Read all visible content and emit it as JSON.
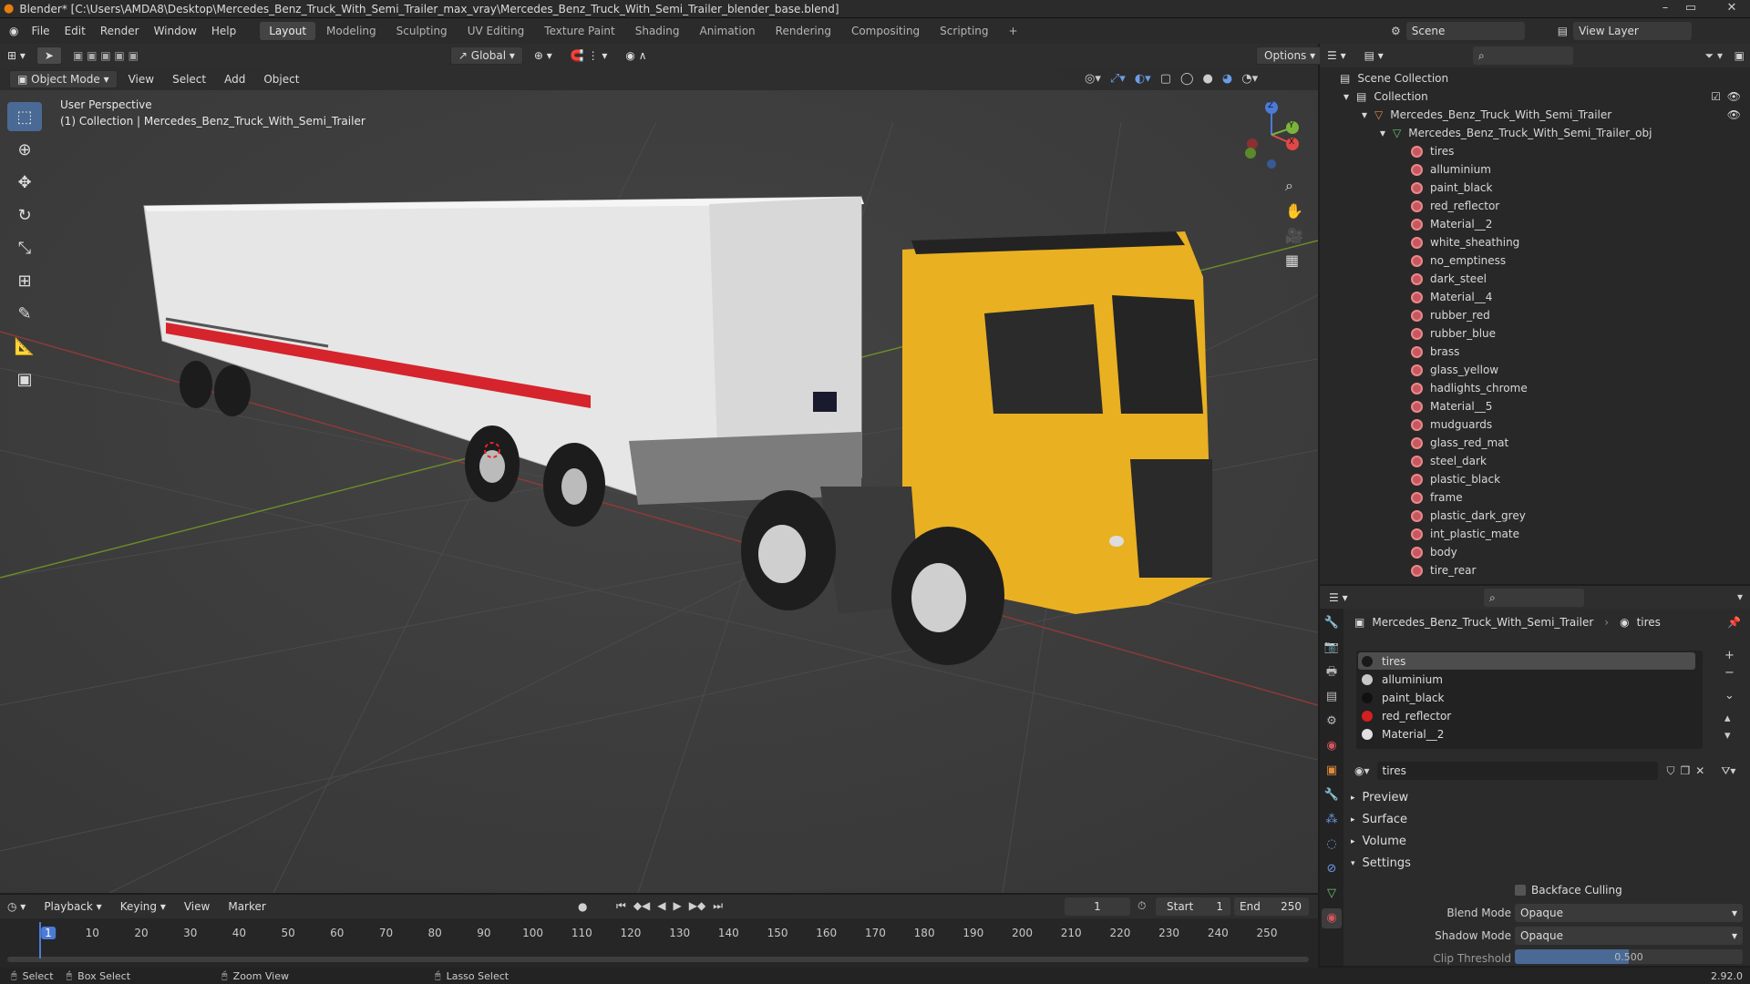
{
  "window": {
    "title": "Blender* [C:\\Users\\AMDA8\\Desktop\\Mercedes_Benz_Truck_With_Semi_Trailer_max_vray\\Mercedes_Benz_Truck_With_Semi_Trailer_blender_base.blend]"
  },
  "menu": [
    "File",
    "Edit",
    "Render",
    "Window",
    "Help"
  ],
  "workspaces": [
    "Layout",
    "Modeling",
    "Sculpting",
    "UV Editing",
    "Texture Paint",
    "Shading",
    "Animation",
    "Rendering",
    "Compositing",
    "Scripting"
  ],
  "active_workspace": "Layout",
  "topbar_right": {
    "scene_label": "Scene",
    "viewlayer_label": "View Layer"
  },
  "viewport": {
    "orientation": "Global",
    "options_label": "Options",
    "mode": "Object Mode",
    "menus": [
      "View",
      "Select",
      "Add",
      "Object"
    ],
    "overlay_line1": "User Perspective",
    "overlay_line2": "(1) Collection | Mercedes_Benz_Truck_With_Semi_Trailer",
    "gizmo": {
      "x": "X",
      "y": "Y",
      "z": "Z"
    }
  },
  "outliner": {
    "scene_collection": "Scene Collection",
    "collection": "Collection",
    "object": "Mercedes_Benz_Truck_With_Semi_Trailer",
    "mesh": "Mercedes_Benz_Truck_With_Semi_Trailer_obj",
    "materials": [
      "tires",
      "alluminium",
      "paint_black",
      "red_reflector",
      "Material__2",
      "white_sheathing",
      "no_emptiness",
      "dark_steel",
      "Material__4",
      "rubber_red",
      "rubber_blue",
      "brass",
      "glass_yellow",
      "hadlights_chrome",
      "Material__5",
      "mudguards",
      "glass_red_mat",
      "steel_dark",
      "plastic_black",
      "frame",
      "plastic_dark_grey",
      "int_plastic_mate",
      "body",
      "tire_rear"
    ]
  },
  "properties": {
    "breadcrumb_object": "Mercedes_Benz_Truck_With_Semi_Trailer",
    "breadcrumb_material": "tires",
    "slots": [
      {
        "name": "tires",
        "color": "#1a1a1a"
      },
      {
        "name": "alluminium",
        "color": "#c8c8c8"
      },
      {
        "name": "paint_black",
        "color": "#111111"
      },
      {
        "name": "red_reflector",
        "color": "#d42020"
      },
      {
        "name": "Material__2",
        "color": "#e0e0e0"
      }
    ],
    "material_name": "tires",
    "sections": [
      "Preview",
      "Surface",
      "Volume",
      "Settings"
    ],
    "backface_culling": "Backface Culling",
    "blend_mode_label": "Blend Mode",
    "blend_mode_value": "Opaque",
    "shadow_mode_label": "Shadow Mode",
    "shadow_mode_value": "Opaque",
    "clip_threshold_label": "Clip Threshold",
    "clip_threshold_value": "0.500"
  },
  "timeline": {
    "menus": [
      "Playback",
      "Keying",
      "View",
      "Marker"
    ],
    "current_frame": "1",
    "start_label": "Start",
    "start_value": "1",
    "end_label": "End",
    "end_value": "250",
    "ticks": [
      "1",
      "10",
      "20",
      "30",
      "40",
      "50",
      "60",
      "70",
      "80",
      "90",
      "100",
      "110",
      "120",
      "130",
      "140",
      "150",
      "160",
      "170",
      "180",
      "190",
      "200",
      "210",
      "220",
      "230",
      "240",
      "250"
    ]
  },
  "status": {
    "select": "Select",
    "box_select": "Box Select",
    "zoom_view": "Zoom View",
    "lasso_select": "Lasso Select",
    "version": "2.92.0"
  }
}
